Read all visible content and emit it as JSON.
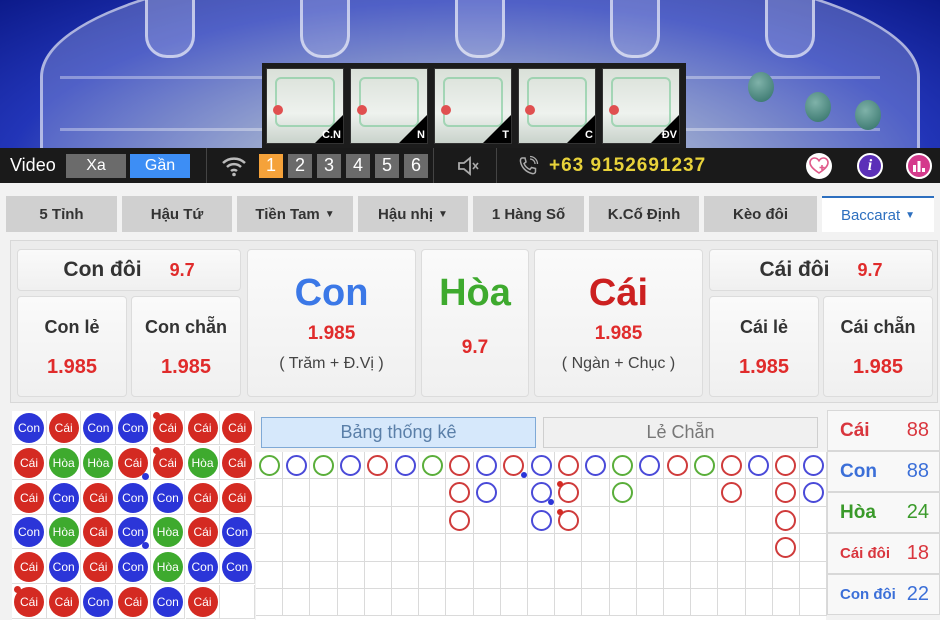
{
  "video": {
    "thumbnails": [
      {
        "label": "C.N"
      },
      {
        "label": "N"
      },
      {
        "label": "T"
      },
      {
        "label": "C"
      },
      {
        "label": "ĐV"
      }
    ]
  },
  "control_bar": {
    "video_label": "Video",
    "far_button": "Xa",
    "near_button": "Gần",
    "selected_view": "Gần",
    "cameras": [
      "1",
      "2",
      "3",
      "4",
      "5",
      "6"
    ],
    "active_camera": "1",
    "phone": "+63 9152691237",
    "icons": [
      "wifi-icon",
      "speaker-icon",
      "phone-icon",
      "favorite-add-icon",
      "info-icon",
      "chart-icon"
    ]
  },
  "tabs": [
    {
      "label": "5 Tỉnh",
      "dropdown": false
    },
    {
      "label": "Hậu Tứ",
      "dropdown": false
    },
    {
      "label": "Tiền Tam",
      "dropdown": true
    },
    {
      "label": "Hậu nhị",
      "dropdown": true
    },
    {
      "label": "1 Hàng Số",
      "dropdown": false
    },
    {
      "label": "K.Cố Định",
      "dropdown": false
    },
    {
      "label": "Kèo đôi",
      "dropdown": false
    },
    {
      "label": "Baccarat",
      "dropdown": true,
      "active": true
    }
  ],
  "bets": {
    "con_doi": {
      "label": "Con đôi",
      "odds": "9.7"
    },
    "con_le": {
      "label": "Con lẻ",
      "odds": "1.985"
    },
    "con_chan": {
      "label": "Con chẵn",
      "odds": "1.985"
    },
    "con": {
      "label": "Con",
      "odds": "1.985",
      "note": "( Trăm + Đ.Vị )"
    },
    "hoa": {
      "label": "Hòa",
      "odds": "9.7"
    },
    "cai": {
      "label": "Cái",
      "odds": "1.985",
      "note": "( Ngàn + Chục )"
    },
    "cai_doi": {
      "label": "Cái đôi",
      "odds": "9.7"
    },
    "cai_le": {
      "label": "Cái lẻ",
      "odds": "1.985"
    },
    "cai_chan": {
      "label": "Cái chẵn",
      "odds": "1.985"
    }
  },
  "bead_plate": {
    "labels": {
      "C": "Cái",
      "P": "Con",
      "T": "Hòa"
    },
    "rows": [
      [
        "P",
        "C",
        "P",
        "P",
        "C",
        "C",
        "C"
      ],
      [
        "C",
        "T",
        "T",
        "C",
        "C",
        "T",
        "C"
      ],
      [
        "C",
        "P",
        "C",
        "P",
        "P",
        "C",
        "C"
      ],
      [
        "P",
        "T",
        "C",
        "P",
        "T",
        "C",
        "P"
      ],
      [
        "C",
        "P",
        "C",
        "P",
        "T",
        "P",
        "P"
      ],
      [
        "C",
        "C",
        "P",
        "C",
        "P",
        "C",
        ""
      ]
    ],
    "dots": [
      {
        "row": 0,
        "col": 4,
        "pos": "tl",
        "color": "red"
      },
      {
        "row": 1,
        "col": 4,
        "pos": "tl",
        "color": "red"
      },
      {
        "row": 1,
        "col": 3,
        "pos": "br",
        "color": "blue"
      },
      {
        "row": 3,
        "col": 3,
        "pos": "br",
        "color": "blue"
      },
      {
        "row": 5,
        "col": 0,
        "pos": "tl",
        "color": "red"
      }
    ]
  },
  "stats_tabs": {
    "active": "Bảng thống kê",
    "inactive": "Lẻ Chẵn"
  },
  "big_road": {
    "columns": [
      {
        "c": "T",
        "n": 1
      },
      {
        "c": "P",
        "n": 1
      },
      {
        "c": "T",
        "n": 1
      },
      {
        "c": "P",
        "n": 1
      },
      {
        "c": "C",
        "n": 1
      },
      {
        "c": "P",
        "n": 1
      },
      {
        "c": "T",
        "n": 1
      },
      {
        "c": "C",
        "n": 3
      },
      {
        "c": "P",
        "n": 2
      },
      {
        "c": "C",
        "n": 1,
        "dots": [
          {
            "row": 0,
            "pos": "br",
            "color": "blue"
          }
        ]
      },
      {
        "c": "P",
        "n": 3,
        "dots": [
          {
            "row": 1,
            "pos": "br",
            "color": "blue"
          }
        ]
      },
      {
        "c": "C",
        "n": 3,
        "dots": [
          {
            "row": 1,
            "pos": "tl",
            "color": "red"
          },
          {
            "row": 2,
            "pos": "tl",
            "color": "red"
          }
        ]
      },
      {
        "c": "P",
        "n": 1
      },
      {
        "c": "T",
        "n": 2
      },
      {
        "c": "P",
        "n": 1
      },
      {
        "c": "C",
        "n": 1
      },
      {
        "c": "T",
        "n": 1
      },
      {
        "c": "C",
        "n": 2
      },
      {
        "c": "P",
        "n": 1
      },
      {
        "c": "C",
        "n": 4
      },
      {
        "c": "P",
        "n": 2
      }
    ]
  },
  "counts": [
    {
      "label": "Cái",
      "value": "88",
      "color": "#d9363e"
    },
    {
      "label": "Con",
      "value": "88",
      "color": "#3b6fd8"
    },
    {
      "label": "Hòa",
      "value": "24",
      "color": "#3a9a2a"
    },
    {
      "label": "Cái đôi",
      "value": "18",
      "color": "#d9363e"
    },
    {
      "label": "Con đôi",
      "value": "22",
      "color": "#3b6fd8"
    }
  ],
  "colors": {
    "cai": "#d42a22",
    "con": "#2b35d8",
    "hoa": "#3eaa2e",
    "accent_blue": "#3d8ef5",
    "active_camera": "#f5a23a",
    "phone": "#e8d23a"
  }
}
